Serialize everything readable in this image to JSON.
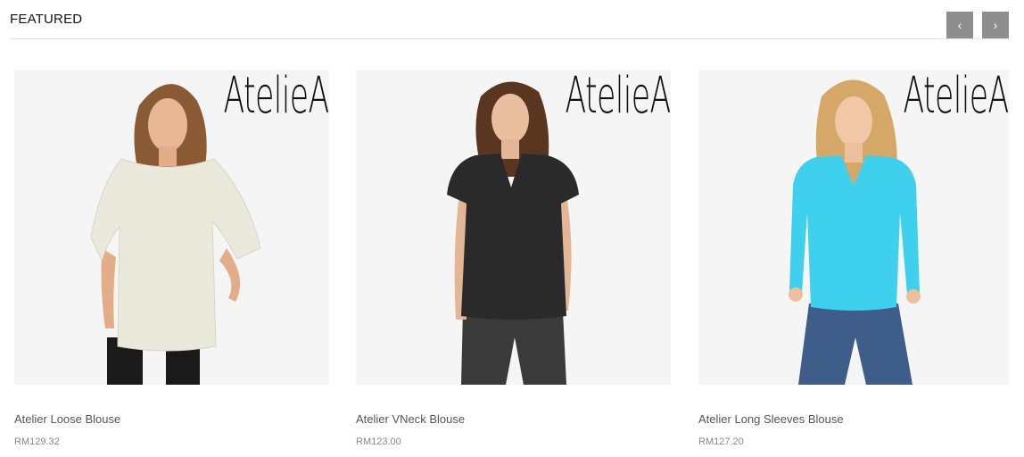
{
  "section": {
    "title": "FEATURED",
    "prev_label": "‹",
    "next_label": "›"
  },
  "brand": "AtelieA",
  "products": [
    {
      "name": "Atelier Loose Blouse",
      "price": "RM129.32",
      "icon": "cream-loose-blouse-photo",
      "top_color": "#ebe9dc"
    },
    {
      "name": "Atelier VNeck Blouse",
      "price": "RM123.00",
      "icon": "black-vneck-blouse-photo",
      "top_color": "#2a2a2a"
    },
    {
      "name": "Atelier Long Sleeves Blouse",
      "price": "RM127.20",
      "icon": "turquoise-long-sleeve-blouse-photo",
      "top_color": "#3ed0ec"
    }
  ]
}
